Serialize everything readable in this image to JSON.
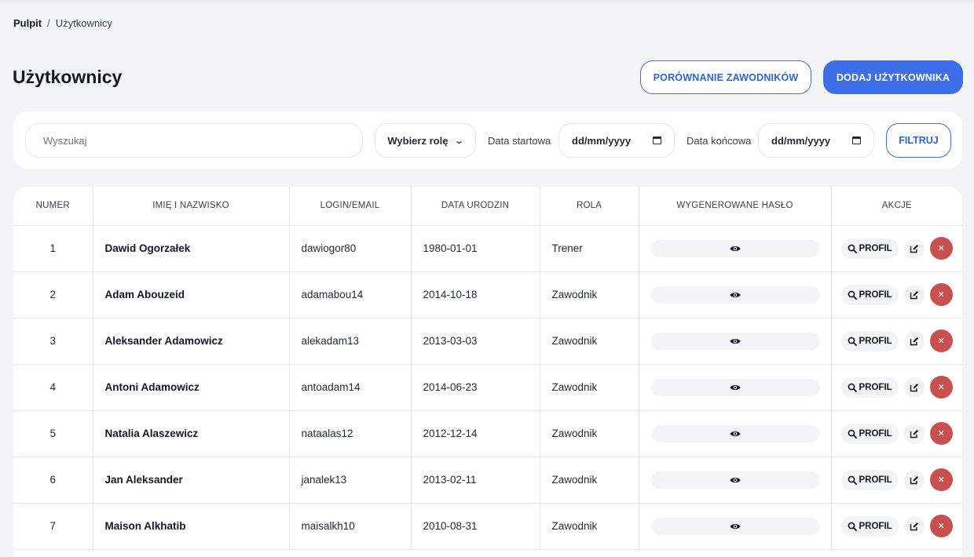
{
  "breadcrumb": {
    "root": "Pulpit",
    "separator": "/",
    "current": "Użytkownicy"
  },
  "page": {
    "title": "Użytkownicy"
  },
  "header_buttons": {
    "compare": "PORÓWNANIE ZAWODNIKÓW",
    "add": "DODAJ UŻYTKOWNIKA"
  },
  "filters": {
    "search_placeholder": "Wyszukaj",
    "role_select": "Wybierz rolę",
    "start_label": "Data startowa",
    "start_value": "dd/mm/yyyy",
    "end_label": "Data końcowa",
    "end_value": "dd/mm/yyyy",
    "filter_button": "FILTRUJ"
  },
  "table": {
    "columns": [
      "NUMER",
      "IMIĘ I NAZWISKO",
      "LOGIN/EMAIL",
      "DATA URODZIN",
      "ROLA",
      "WYGENEROWANE HASŁO",
      "AKCJE"
    ],
    "profile_label": "PROFIL",
    "rows": [
      {
        "num": "1",
        "name": "Dawid Ogorzałek",
        "login": "dawiogor80",
        "birth": "1980-01-01",
        "role": "Trener"
      },
      {
        "num": "2",
        "name": "Adam Abouzeid",
        "login": "adamabou14",
        "birth": "2014-10-18",
        "role": "Zawodnik"
      },
      {
        "num": "3",
        "name": "Aleksander Adamowicz",
        "login": "alekadam13",
        "birth": "2013-03-03",
        "role": "Zawodnik"
      },
      {
        "num": "4",
        "name": "Antoni Adamowicz",
        "login": "antoadam14",
        "birth": "2014-06-23",
        "role": "Zawodnik"
      },
      {
        "num": "5",
        "name": "Natalia Alaszewicz",
        "login": "nataalas12",
        "birth": "2012-12-14",
        "role": "Zawodnik"
      },
      {
        "num": "6",
        "name": "Jan Aleksander",
        "login": "janalek13",
        "birth": "2013-02-11",
        "role": "Zawodnik"
      },
      {
        "num": "7",
        "name": "Maison Alkhatib",
        "login": "maisalkh10",
        "birth": "2010-08-31",
        "role": "Zawodnik"
      }
    ]
  },
  "icons": {
    "password": "eye-icon",
    "profile": "search-icon",
    "edit": "edit-icon",
    "delete": "close-icon",
    "role_select": "chevron-down-icon",
    "date": "calendar-icon"
  },
  "colors": {
    "primary": "#3b6ee8",
    "danger": "#c8504e",
    "background": "#f3f4f6"
  }
}
